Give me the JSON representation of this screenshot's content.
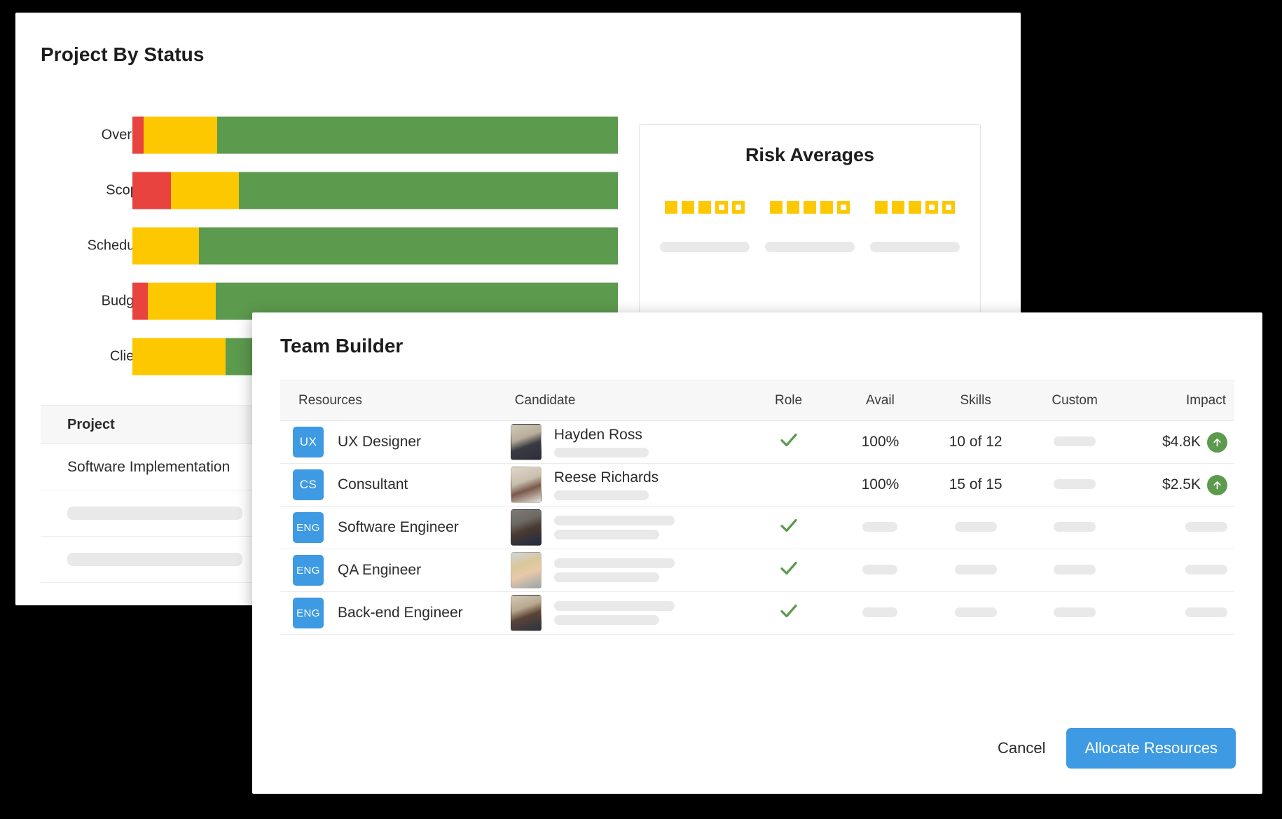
{
  "back_card": {
    "title": "Project By Status",
    "project_table": {
      "header": "Project",
      "rows": [
        {
          "name": "Software Implementation",
          "placeholder": false
        },
        {
          "name": "",
          "placeholder": true
        },
        {
          "name": "",
          "placeholder": true
        }
      ]
    }
  },
  "risk_panel": {
    "title": "Risk Averages",
    "groups": [
      {
        "filled": 3,
        "total": 5
      },
      {
        "filled": 4,
        "total": 5
      },
      {
        "filled": 3,
        "total": 5
      }
    ]
  },
  "modal": {
    "title": "Team Builder",
    "columns": [
      "Resources",
      "Candidate",
      "Role",
      "Avail",
      "Skills",
      "Custom",
      "Impact"
    ],
    "rows": [
      {
        "badge": "UX",
        "resource": "UX Designer",
        "candidate": "Hayden Ross",
        "candidate_placeholder": false,
        "role_check": true,
        "avail": "100%",
        "skills": "10 of 12",
        "custom": "",
        "impact": "$4.8K",
        "impact_up": true
      },
      {
        "badge": "CS",
        "resource": "Consultant",
        "candidate": "Reese Richards",
        "candidate_placeholder": false,
        "role_check": false,
        "avail": "100%",
        "skills": "15 of 15",
        "custom": "",
        "impact": "$2.5K",
        "impact_up": true
      },
      {
        "badge": "ENG",
        "resource": "Software Engineer",
        "candidate": "",
        "candidate_placeholder": true,
        "role_check": true,
        "avail": "",
        "skills": "",
        "custom": "",
        "impact": "",
        "impact_up": false
      },
      {
        "badge": "ENG",
        "resource": "QA Engineer",
        "candidate": "",
        "candidate_placeholder": true,
        "role_check": true,
        "avail": "",
        "skills": "",
        "custom": "",
        "impact": "",
        "impact_up": false
      },
      {
        "badge": "ENG",
        "resource": "Back-end Engineer",
        "candidate": "",
        "candidate_placeholder": true,
        "role_check": true,
        "avail": "",
        "skills": "",
        "custom": "",
        "impact": "",
        "impact_up": false
      }
    ],
    "cancel_label": "Cancel",
    "primary_label": "Allocate Resources"
  },
  "colors": {
    "red": "#e8433f",
    "yellow": "#fdc800",
    "green": "#5c9a4e",
    "blue": "#3d9ae3",
    "placeholder": "#e9e9e9"
  },
  "chart_data": {
    "type": "bar",
    "title": "Project By Status",
    "orientation": "horizontal",
    "stacked": true,
    "normalized": true,
    "xlabel": "",
    "ylabel": "",
    "grid": false,
    "legend": "none",
    "xlim": [
      0,
      100
    ],
    "categories": [
      "Overall",
      "Scope",
      "Schedule",
      "Budget",
      "Client"
    ],
    "series": [
      {
        "name": "Red",
        "color": "#e8433f",
        "values": [
          2.3,
          7.9,
          0.0,
          3.2,
          0.0
        ]
      },
      {
        "name": "Yellow",
        "color": "#fdc800",
        "values": [
          15.2,
          14.1,
          13.7,
          14.0,
          19.2
        ]
      },
      {
        "name": "Green",
        "color": "#5c9a4e",
        "values": [
          82.5,
          78.0,
          86.3,
          82.8,
          80.8
        ]
      }
    ]
  }
}
